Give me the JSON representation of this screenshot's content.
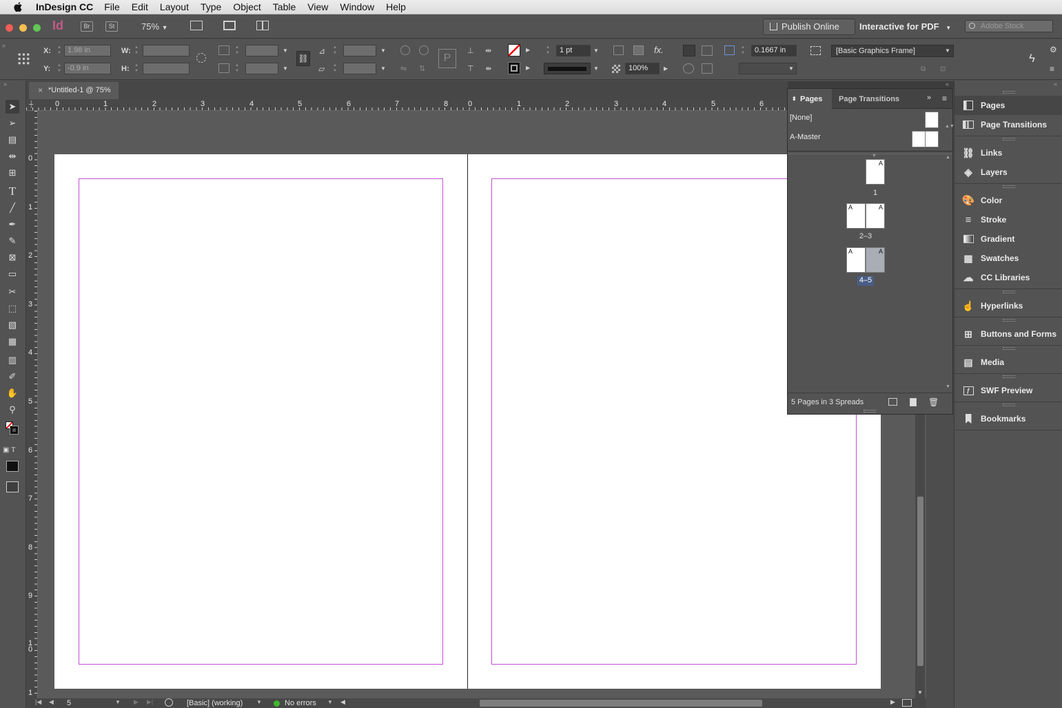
{
  "menubar": {
    "app_name": "InDesign CC",
    "items": [
      "File",
      "Edit",
      "Layout",
      "Type",
      "Object",
      "Table",
      "View",
      "Window",
      "Help"
    ]
  },
  "appbar": {
    "logo": "Id",
    "bridge": "Br",
    "stock_btn": "St",
    "zoom": "75%",
    "publish_label": "Publish Online",
    "workspace": "Interactive for PDF",
    "search_placeholder": "Adobe Stock"
  },
  "control": {
    "x_label": "X:",
    "y_label": "Y:",
    "w_label": "W:",
    "h_label": "H:",
    "x_value": "1.98 in",
    "y_value": "-0.9 in",
    "stroke_weight": "1 pt",
    "opacity": "100%",
    "fitting_value": "0.1667 in",
    "object_style": "[Basic Graphics Frame]"
  },
  "document": {
    "tab_title": "*Untitled-1 @ 75%"
  },
  "rulers": {
    "horizontal": [
      "0",
      "1",
      "2",
      "3",
      "4",
      "5",
      "6",
      "7",
      "8",
      "0",
      "1",
      "2",
      "3",
      "4",
      "5",
      "6"
    ],
    "vertical": [
      "0",
      "1",
      "2",
      "3",
      "4",
      "5",
      "6",
      "7",
      "8",
      "9",
      "1\n0",
      "1"
    ]
  },
  "status": {
    "page_number": "5",
    "preflight_profile": "[Basic] (working)",
    "errors": "No errors"
  },
  "pages_panel": {
    "tab_pages": "Pages",
    "tab_transitions": "Page Transitions",
    "master_none": "[None]",
    "master_a": "A-Master",
    "spread_labels": [
      "1",
      "2–3",
      "4–5"
    ],
    "page_letter": "A",
    "footer": "5 Pages in 3 Spreads"
  },
  "dock": {
    "items": [
      "Pages",
      "Page Transitions",
      "Links",
      "Layers",
      "Color",
      "Stroke",
      "Gradient",
      "Swatches",
      "CC Libraries",
      "Hyperlinks",
      "Buttons and Forms",
      "Media",
      "SWF Preview",
      "Bookmarks"
    ]
  },
  "colors": {
    "margin_guide": "#c050d0",
    "app_bg": "#535353",
    "logo": "#c25b87"
  }
}
